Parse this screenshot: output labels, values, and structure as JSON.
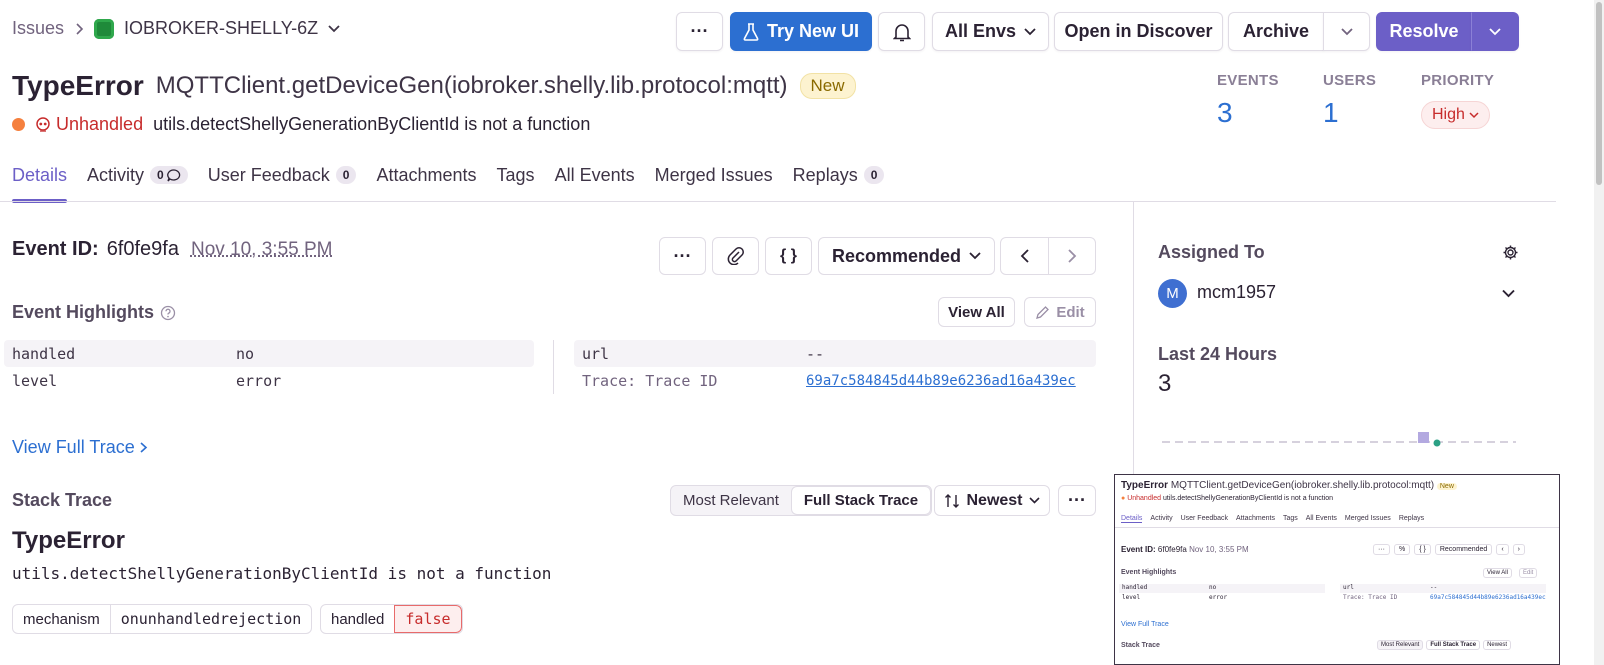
{
  "breadcrumb": {
    "root": "Issues",
    "project": "IOBROKER-SHELLY-6Z"
  },
  "toolbar": {
    "more_label": "···",
    "try_new_ui": "Try New UI",
    "env_select": "All Envs",
    "open_discover": "Open in Discover",
    "archive": "Archive",
    "resolve": "Resolve"
  },
  "issue": {
    "type": "TypeError",
    "culprit": "MQTTClient.getDeviceGen(iobroker.shelly.lib.protocol:mqtt)",
    "status_badge": "New",
    "unhandled_label": "Unhandled",
    "message": "utils.detectShellyGenerationByClientId is not a function"
  },
  "stats": {
    "events_label": "EVENTS",
    "events_value": "3",
    "users_label": "USERS",
    "users_value": "1",
    "priority_label": "PRIORITY",
    "priority_value": "High"
  },
  "tabs": [
    {
      "label": "Details"
    },
    {
      "label": "Activity",
      "count": "0"
    },
    {
      "label": "User Feedback",
      "count": "0"
    },
    {
      "label": "Attachments"
    },
    {
      "label": "Tags"
    },
    {
      "label": "All Events"
    },
    {
      "label": "Merged Issues"
    },
    {
      "label": "Replays",
      "count": "0"
    }
  ],
  "event": {
    "id_label": "Event ID:",
    "id": "6f0fe9fa",
    "date": "Nov 10, 3:55 PM",
    "more_label": "···",
    "json_label": "{ }",
    "recommended": "Recommended"
  },
  "highlights": {
    "title": "Event Highlights",
    "view_all": "View All",
    "edit": "Edit",
    "left": [
      {
        "key": "handled",
        "value": "no"
      },
      {
        "key": "level",
        "value": "error"
      }
    ],
    "right": [
      {
        "key": "url",
        "value": "--"
      },
      {
        "key": "Trace: Trace ID",
        "value": "69a7c584845d44b89e6236ad16a439ec"
      }
    ]
  },
  "view_full_trace": "View Full Trace",
  "stack": {
    "title": "Stack Trace",
    "most_relevant": "Most Relevant",
    "full_stack": "Full Stack Trace",
    "sort": "Newest",
    "more_label": "···",
    "exception_type": "TypeError",
    "exception_message": "utils.detectShellyGenerationByClientId is not a function",
    "mechanism_key": "mechanism",
    "mechanism_value": "onunhandledrejection",
    "handled_key": "handled",
    "handled_value": "false"
  },
  "sidebar": {
    "assigned_title": "Assigned To",
    "avatar_initial": "M",
    "assignee": "mcm1957",
    "last24_title": "Last 24 Hours",
    "last24_value": "3"
  },
  "colors": {
    "accent_purple": "#6c5fc7",
    "accent_blue": "#2c6fd1",
    "error_red": "#c72c2c",
    "status_orange": "#f5803e"
  }
}
